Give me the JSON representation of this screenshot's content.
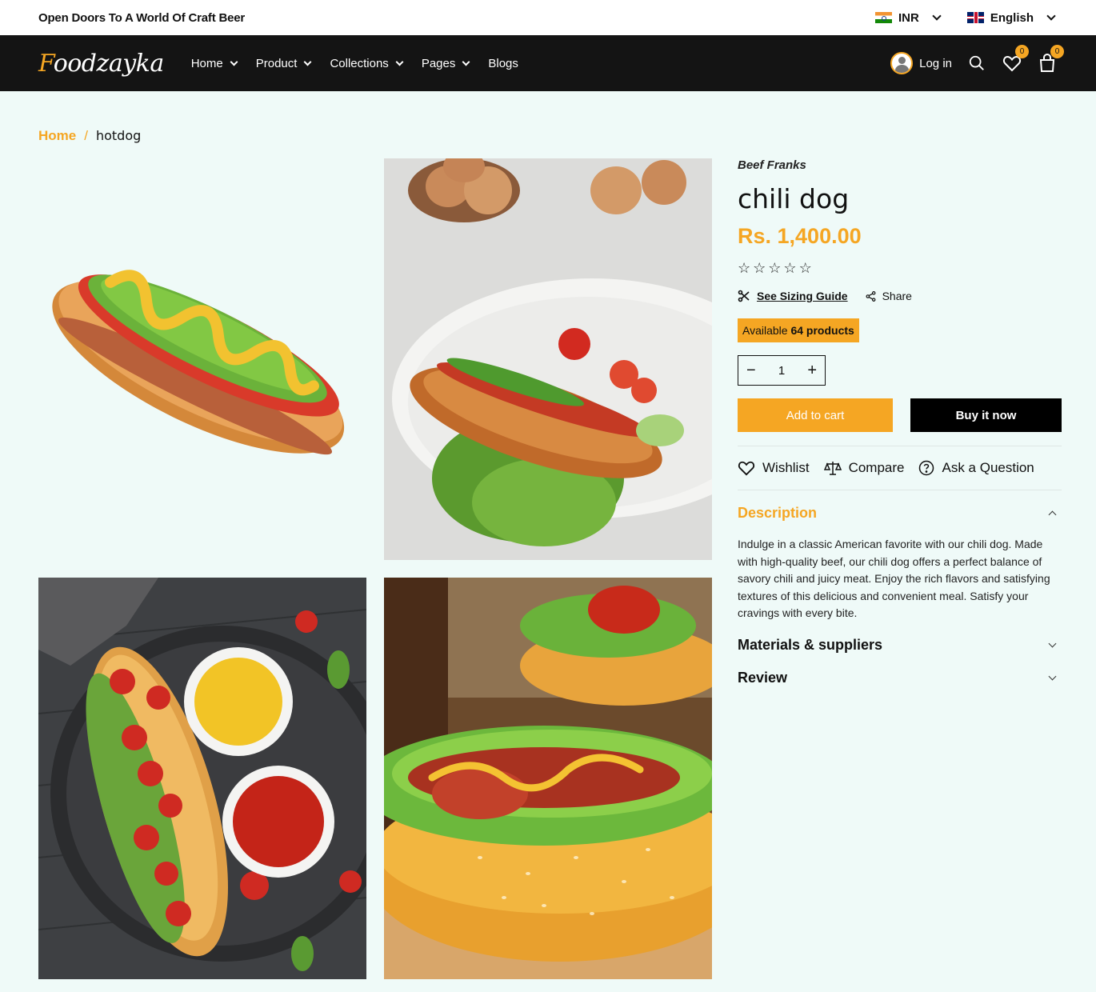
{
  "topbar": {
    "announcement": "Open Doors To A World Of Craft Beer",
    "currency": "INR",
    "language": "English"
  },
  "header": {
    "logo_first": "F",
    "logo_rest": "oodzayka",
    "nav": [
      "Home",
      "Product",
      "Collections",
      "Pages",
      "Blogs"
    ],
    "login": "Log in",
    "wishlist_count": "0",
    "cart_count": "0"
  },
  "breadcrumb": {
    "home": "Home",
    "separator": "/",
    "current": "hotdog"
  },
  "product": {
    "vendor": "Beef Franks",
    "title": "chili dog",
    "price": "Rs. 1,400.00",
    "rating": 0,
    "rating_max": 5,
    "sizing_guide": "See Sizing Guide",
    "share": "Share",
    "availability_prefix": "Available",
    "availability_count": "64 products",
    "quantity": "1",
    "add_to_cart": "Add to cart",
    "buy_now": "Buy it now",
    "wishlist": "Wishlist",
    "compare": "Compare",
    "ask": "Ask a Question",
    "description_title": "Description",
    "description": "Indulge in a classic American favorite with our chili dog. Made with high-quality beef, our chili dog offers a perfect balance of savory chili and juicy meat. Enjoy the rich flavors and satisfying textures of this delicious and convenient meal. Satisfy your cravings with every bite.",
    "materials_title": "Materials & suppliers",
    "review_title": "Review"
  },
  "colors": {
    "accent": "#f5a623",
    "header_bg": "#141414",
    "page_bg": "#effaf8"
  }
}
